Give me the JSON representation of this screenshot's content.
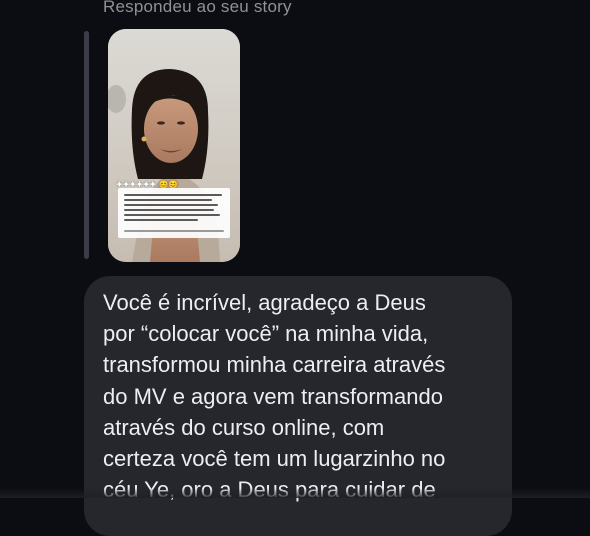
{
  "reply_label": "Respondeu ao seu story",
  "story": {
    "thumbnail_icon": "story-photo-icon"
  },
  "message": {
    "text": "Você é incrível, agradeço a Deus\npor “colocar você” na minha vida,\ntransformou minha carreira através\ndo MV e agora vem transformando\natravés do curso online, com\ncerteza você tem um lugarzinho no\ncéu Ye, oro a Deus para cuidar de"
  },
  "colors": {
    "background": "#0b0d12",
    "bubble": "#25272d",
    "text": "#eceef1",
    "secondary_text": "#8e9197",
    "quote_bar": "#3a3d45"
  }
}
